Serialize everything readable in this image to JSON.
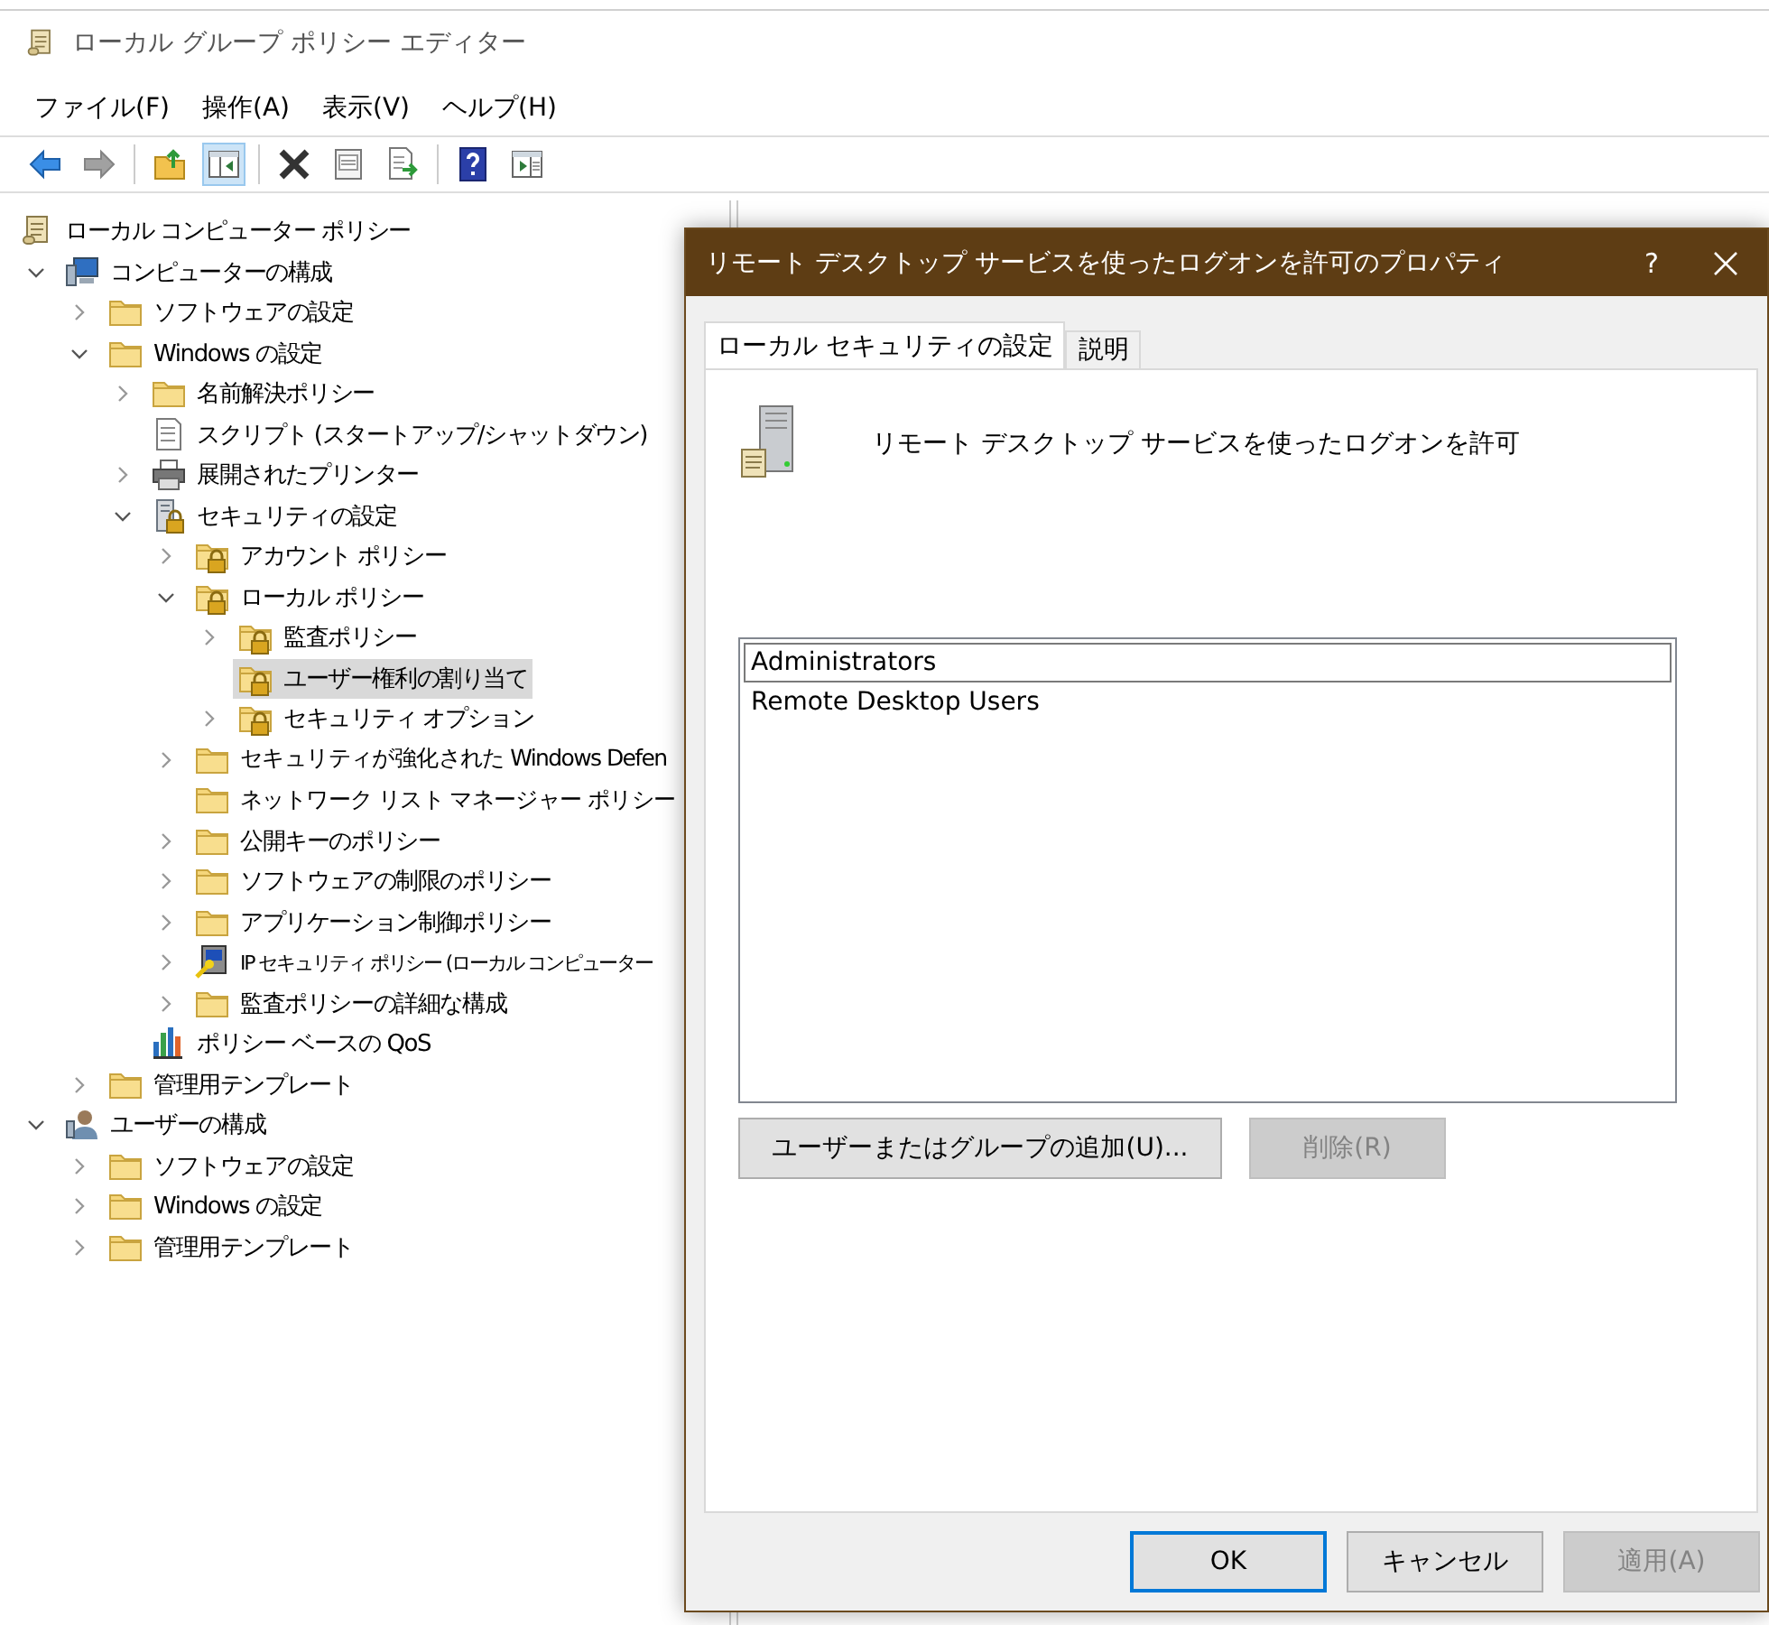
{
  "window": {
    "title": "ローカル グループ ポリシー エディター"
  },
  "menu": [
    "ファイル(F)",
    "操作(A)",
    "表示(V)",
    "ヘルプ(H)"
  ],
  "toolbar": [
    [
      {
        "kind": "back",
        "disabled": false,
        "pressed": false
      },
      {
        "kind": "forward",
        "disabled": true,
        "pressed": false
      }
    ],
    [
      {
        "kind": "up",
        "disabled": false,
        "pressed": false
      },
      {
        "kind": "tree",
        "disabled": false,
        "pressed": true
      }
    ],
    [
      {
        "kind": "delete",
        "disabled": false,
        "pressed": false
      },
      {
        "kind": "properties",
        "disabled": false,
        "pressed": false
      },
      {
        "kind": "export",
        "disabled": false,
        "pressed": false
      }
    ],
    [
      {
        "kind": "help",
        "disabled": false,
        "pressed": false
      },
      {
        "kind": "actionpane",
        "disabled": false,
        "pressed": false
      }
    ]
  ],
  "tree": [
    {
      "label": "ローカル コンピューター ポリシー",
      "kind": "scroll",
      "selected": false,
      "children": [
        {
          "label": "コンピューターの構成",
          "kind": "computer",
          "selected": false,
          "expanded": true,
          "children": [
            {
              "label": "ソフトウェアの設定",
              "kind": "folder",
              "selected": false,
              "expanded": false
            },
            {
              "label": "Windows の設定",
              "kind": "folder",
              "selected": false,
              "expanded": true,
              "children": [
                {
                  "label": "名前解決ポリシー",
                  "kind": "folder",
                  "selected": false,
                  "expanded": false
                },
                {
                  "label": "スクリプト (スタートアップ/シャットダウン)",
                  "kind": "script",
                  "selected": false
                },
                {
                  "label": "展開されたプリンター",
                  "kind": "printer",
                  "selected": false,
                  "expanded": false
                },
                {
                  "label": "セキュリティの設定",
                  "kind": "secserver",
                  "selected": false,
                  "expanded": true,
                  "children": [
                    {
                      "label": "アカウント ポリシー",
                      "kind": "lockfolder",
                      "selected": false,
                      "expanded": false
                    },
                    {
                      "label": "ローカル ポリシー",
                      "kind": "lockfolder",
                      "selected": false,
                      "expanded": true,
                      "children": [
                        {
                          "label": "監査ポリシー",
                          "kind": "lockfolder",
                          "selected": false,
                          "expanded": false
                        },
                        {
                          "label": "ユーザー権利の割り当て",
                          "kind": "lockfolder",
                          "selected": true
                        },
                        {
                          "label": "セキュリティ オプション",
                          "kind": "lockfolder",
                          "selected": false,
                          "expanded": false
                        }
                      ]
                    },
                    {
                      "label": "セキュリティが強化された Windows Defen",
                      "kind": "folder",
                      "selected": false,
                      "expanded": false
                    },
                    {
                      "label": "ネットワーク リスト マネージャー ポリシー",
                      "kind": "folder",
                      "selected": false
                    },
                    {
                      "label": "公開キーのポリシー",
                      "kind": "folder",
                      "selected": false,
                      "expanded": false
                    },
                    {
                      "label": "ソフトウェアの制限のポリシー",
                      "kind": "folder",
                      "selected": false,
                      "expanded": false
                    },
                    {
                      "label": "アプリケーション制御ポリシー",
                      "kind": "folder",
                      "selected": false,
                      "expanded": false
                    },
                    {
                      "label": "IP セキュリティ ポリシー (ローカル コンピューター",
                      "kind": "ip",
                      "selected": false,
                      "expanded": false
                    },
                    {
                      "label": "監査ポリシーの詳細な構成",
                      "kind": "folder",
                      "selected": false,
                      "expanded": false
                    }
                  ]
                },
                {
                  "label": "ポリシー ベースの QoS",
                  "kind": "qos",
                  "selected": false
                }
              ]
            },
            {
              "label": "管理用テンプレート",
              "kind": "folder",
              "selected": false,
              "expanded": false
            }
          ]
        },
        {
          "label": "ユーザーの構成",
          "kind": "user",
          "selected": false,
          "expanded": true,
          "children": [
            {
              "label": "ソフトウェアの設定",
              "kind": "folder",
              "selected": false,
              "expanded": false
            },
            {
              "label": "Windows の設定",
              "kind": "folder",
              "selected": false,
              "expanded": false
            },
            {
              "label": "管理用テンプレート",
              "kind": "folder",
              "selected": false,
              "expanded": false
            }
          ]
        }
      ]
    }
  ],
  "dialog": {
    "title": "リモート デスクトップ サービスを使ったログオンを許可のプロパティ",
    "help": "?",
    "tabs": [
      {
        "label": "ローカル セキュリティの設定",
        "selected": true
      },
      {
        "label": "説明",
        "selected": false
      }
    ],
    "policy": "リモート デスクトップ サービスを使ったログオンを許可",
    "members": [
      {
        "name": "Administrators",
        "selected": true
      },
      {
        "name": "Remote Desktop Users",
        "selected": false
      }
    ],
    "member_buttons": [
      {
        "label": "ユーザーまたはグループの追加(U)...",
        "disabled": false
      },
      {
        "label": "削除(R)",
        "disabled": true
      }
    ],
    "buttons": [
      {
        "label": "OK",
        "default": true,
        "disabled": false
      },
      {
        "label": "キャンセル",
        "default": false,
        "disabled": false
      },
      {
        "label": "適用(A)",
        "default": false,
        "disabled": true
      }
    ]
  }
}
